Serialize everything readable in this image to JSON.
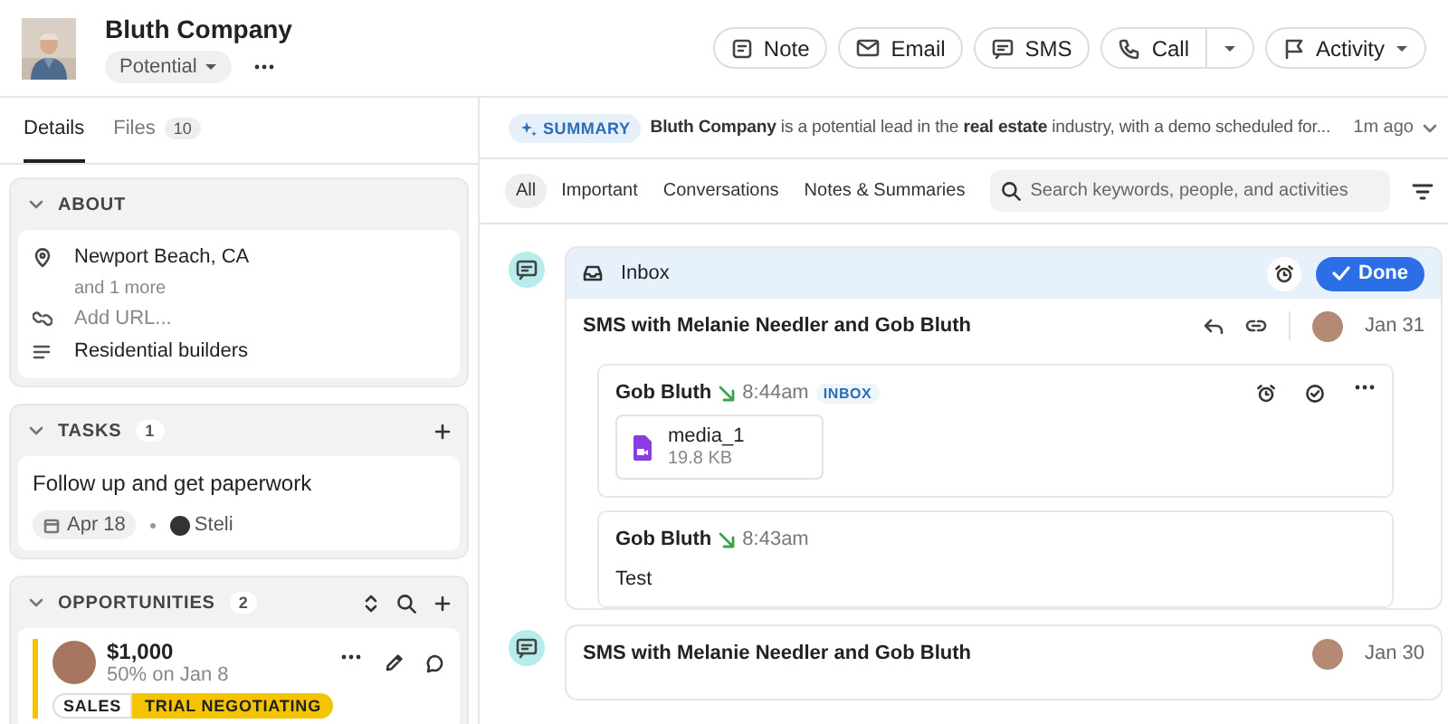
{
  "header": {
    "title": "Bluth Company",
    "status": "Potential",
    "actions": [
      {
        "kind": "note",
        "label": "Note"
      },
      {
        "kind": "email",
        "label": "Email"
      },
      {
        "kind": "sms",
        "label": "SMS"
      },
      {
        "kind": "call",
        "label": "Call"
      },
      {
        "kind": "activity",
        "label": "Activity"
      }
    ]
  },
  "left_tabs": [
    {
      "label": "Details",
      "selected": true
    },
    {
      "label": "Files",
      "count": "10",
      "selected": false
    }
  ],
  "about": {
    "title": "ABOUT",
    "rows": [
      {
        "kind": "location",
        "text": "Newport Beach, CA"
      },
      {
        "kind": "more",
        "text": "and 1 more"
      },
      {
        "kind": "url",
        "placeholder": "Add URL..."
      },
      {
        "kind": "description",
        "text": "Residential builders"
      }
    ]
  },
  "tasks": {
    "title": "TASKS",
    "count": "1",
    "items": [
      {
        "title": "Follow up and get paperwork",
        "date": "Apr 18",
        "assignee": "Steli"
      }
    ]
  },
  "opportunities": {
    "title": "OPPORTUNITIES",
    "count": "2",
    "items": [
      {
        "value": "$1,000",
        "detail": "50% on Jan 8",
        "pipeline": "SALES",
        "stage": "TRIAL NEGOTIATING",
        "color": "#f5c400"
      }
    ]
  },
  "summary": {
    "badge": "SUMMARY",
    "text": "**Bluth Company** is a potential lead in the **real estate** industry, with a demo scheduled for...",
    "time": "1m ago"
  },
  "filters": [
    {
      "label": "All",
      "selected": true
    },
    {
      "label": "Important",
      "selected": false
    },
    {
      "label": "Conversations",
      "selected": false
    },
    {
      "label": "Notes & Summaries",
      "selected": false
    }
  ],
  "search": {
    "placeholder": "Search keywords, people, and activities"
  },
  "feed": [
    {
      "kind": "sms",
      "inbox": {
        "label": "Inbox",
        "action": "Done"
      },
      "title": "SMS with Melanie Needler and Gob Bluth",
      "date": "Jan 31",
      "messages": [
        {
          "sender": "Gob Bluth",
          "incoming": true,
          "time": "8:44am",
          "tag": "INBOX",
          "attachment": {
            "name": "media_1",
            "size": "19.8 KB"
          }
        },
        {
          "sender": "Gob Bluth",
          "incoming": true,
          "time": "8:43am",
          "text": "Test"
        }
      ]
    },
    {
      "kind": "sms",
      "title": "SMS with Melanie Needler and Gob Bluth",
      "date": "Jan 30"
    }
  ]
}
